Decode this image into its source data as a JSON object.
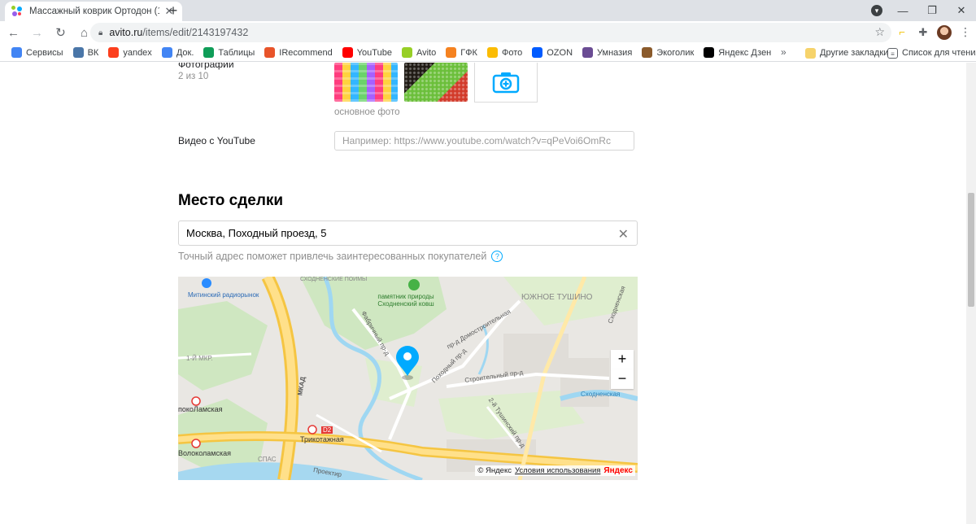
{
  "browser": {
    "tab_title": "Массажный коврик Ортодон (1",
    "url_host": "avito.ru",
    "url_path": "/items/edit/2143197432",
    "bookmarks": [
      {
        "label": "Сервисы",
        "icon": "apps-grid-icon",
        "color": "#4285f4"
      },
      {
        "label": "ВК",
        "icon": "vk-icon",
        "color": "#4a76a8"
      },
      {
        "label": "yandex",
        "icon": "yandex-icon",
        "color": "#fc3f1d"
      },
      {
        "label": "Док.",
        "icon": "docs-icon",
        "color": "#4285f4"
      },
      {
        "label": "Таблицы",
        "icon": "sheets-icon",
        "color": "#0f9d58"
      },
      {
        "label": "IRecommend",
        "icon": "irecommend-icon",
        "color": "#e8542a"
      },
      {
        "label": "YouTube",
        "icon": "youtube-icon",
        "color": "#ff0000"
      },
      {
        "label": "Avito",
        "icon": "avito-icon",
        "color": "#97cf26"
      },
      {
        "label": "ГФК",
        "icon": "gfk-icon",
        "color": "#f58220"
      },
      {
        "label": "Фото",
        "icon": "photos-icon",
        "color": "#fbbc04"
      },
      {
        "label": "OZON",
        "icon": "ozon-icon",
        "color": "#005bff"
      },
      {
        "label": "Умназия",
        "icon": "umnazia-icon",
        "color": "#6a4c93"
      },
      {
        "label": "Экоголик",
        "icon": "ekogolik-icon",
        "color": "#8a5a2b"
      },
      {
        "label": "Яндекс Дзен",
        "icon": "zen-icon",
        "color": "#000000"
      }
    ],
    "bookmarks_more": "»",
    "other_bookmarks": "Другие закладки",
    "reading_list": "Список для чтения"
  },
  "form": {
    "photos_label": "Фотографии",
    "photos_count": "2 из 10",
    "main_photo_caption": "основное фото",
    "video_label": "Видео с YouTube",
    "video_placeholder": "Например: https://www.youtube.com/watch?v=qPeVoi6OmRc",
    "deal_place_title": "Место сделки",
    "address_value": "Москва, Походный проезд, 5",
    "address_hint": "Точный адрес поможет привлечь заинтересованных покупателей"
  },
  "map": {
    "zoom_in": "+",
    "zoom_out": "−",
    "attribution": "© Яндекс",
    "terms": "Условия использования",
    "logo": "Яндекс",
    "labels": {
      "mitinsky_market": "Митинский радиорынок",
      "nature_monument": "памятник природы Сходненский ковш",
      "yuzhnoe_tushino": "ЮЖНОЕ ТУШИНО",
      "mkad": "МКАД",
      "fabrichny": "Фабричный пр-д",
      "domostroitelnaya": "пр-д Домостроительная",
      "pokhodny": "Походный пр-д",
      "stroitelny": "Строительный пр-д",
      "skhodnenskaya": "Сходненская",
      "trikotazhnaya": "Трикотажная",
      "volokolamskaya": "Волоколамская",
      "pokolamskaya": "покоЛамская",
      "mkr": "1-Й МКР.",
      "spas": "СПАС",
      "tushinsky": "2-й Тушинский пр-д",
      "d2": "D2",
      "proektiruemy": "Проектир",
      "svodnenskie": "СХОДНЕНСКИЕ ПОЙМЫ"
    }
  }
}
